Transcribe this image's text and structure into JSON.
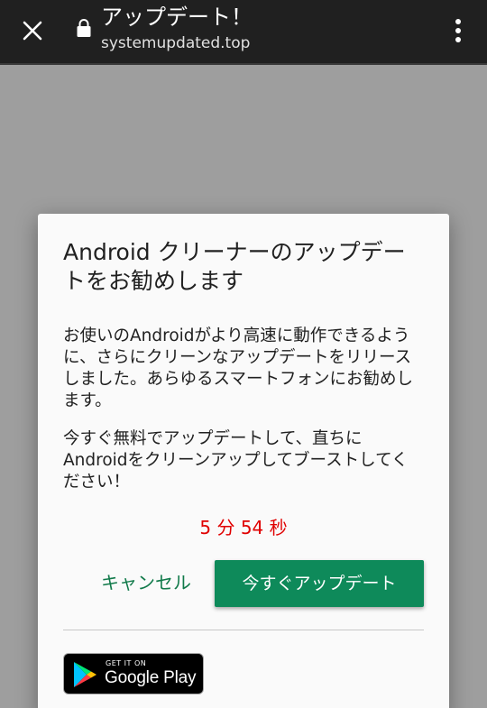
{
  "browser": {
    "close_icon": "close-icon",
    "lock_icon": "lock-icon",
    "page_title": "アップデート！",
    "url": "systemupdated.top",
    "menu_icon": "more-vert-icon"
  },
  "dialog": {
    "title": "Android クリーナーのアップデートをお勧めします",
    "paragraph1": "お使いのAndroidがより高速に動作できるように、さらにクリーンなアップデートをリリースしました。あらゆるスマートフォンにお勧めします。",
    "paragraph2": "今すぐ無料でアップデートして、直ちにAndroidをクリーンアップしてブーストしてください！",
    "countdown": "5 分 54 秒",
    "cancel_label": "キャンセル",
    "update_label": "今すぐアップデート",
    "badge": {
      "top_text": "GET IT ON",
      "main_text": "Google Play",
      "icon": "google-play-icon"
    }
  },
  "colors": {
    "toolbar_bg": "#202020",
    "overlay_bg": "#9e9e9e",
    "dialog_bg": "#fafafa",
    "accent_green": "#0e8a5a",
    "cancel_green": "#117a4a",
    "countdown_red": "#e00000"
  }
}
